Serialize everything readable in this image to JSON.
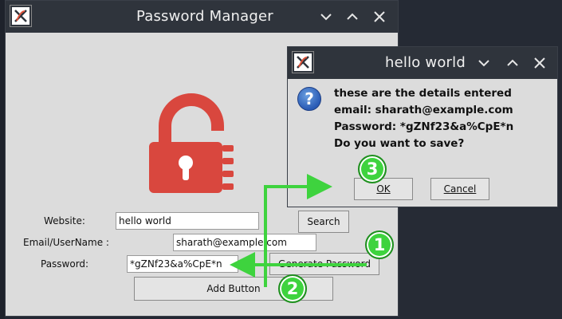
{
  "main_window": {
    "title": "Password Manager",
    "form": {
      "website_label": "Website:",
      "website_value": "hello world",
      "search_label": "Search",
      "email_label": "Email/UserName :",
      "email_value": "sharath@example.com",
      "password_label": "Password:",
      "password_value": "*gZNf23&a%CpE*n",
      "generate_label": "Generate Password",
      "add_label": "Add Button"
    }
  },
  "dialog": {
    "title": "hello world",
    "lines": [
      "these are the details entered",
      "email: sharath@example.com",
      "Password: *gZNf23&a%CpE*n",
      "Do you want to save?"
    ],
    "ok_label": "OK",
    "cancel_label": "Cancel"
  },
  "annotations": {
    "step1": "1",
    "step2": "2",
    "step3": "3",
    "color": "#3ed33e"
  },
  "colors": {
    "lock_red": "#d9473e",
    "titlebar": "#2f343c",
    "window_bg": "#dcdcdc"
  },
  "icons": [
    "x-app-icon",
    "chevron-down-icon",
    "chevron-up-icon",
    "close-icon",
    "lock-icon",
    "question-icon"
  ]
}
